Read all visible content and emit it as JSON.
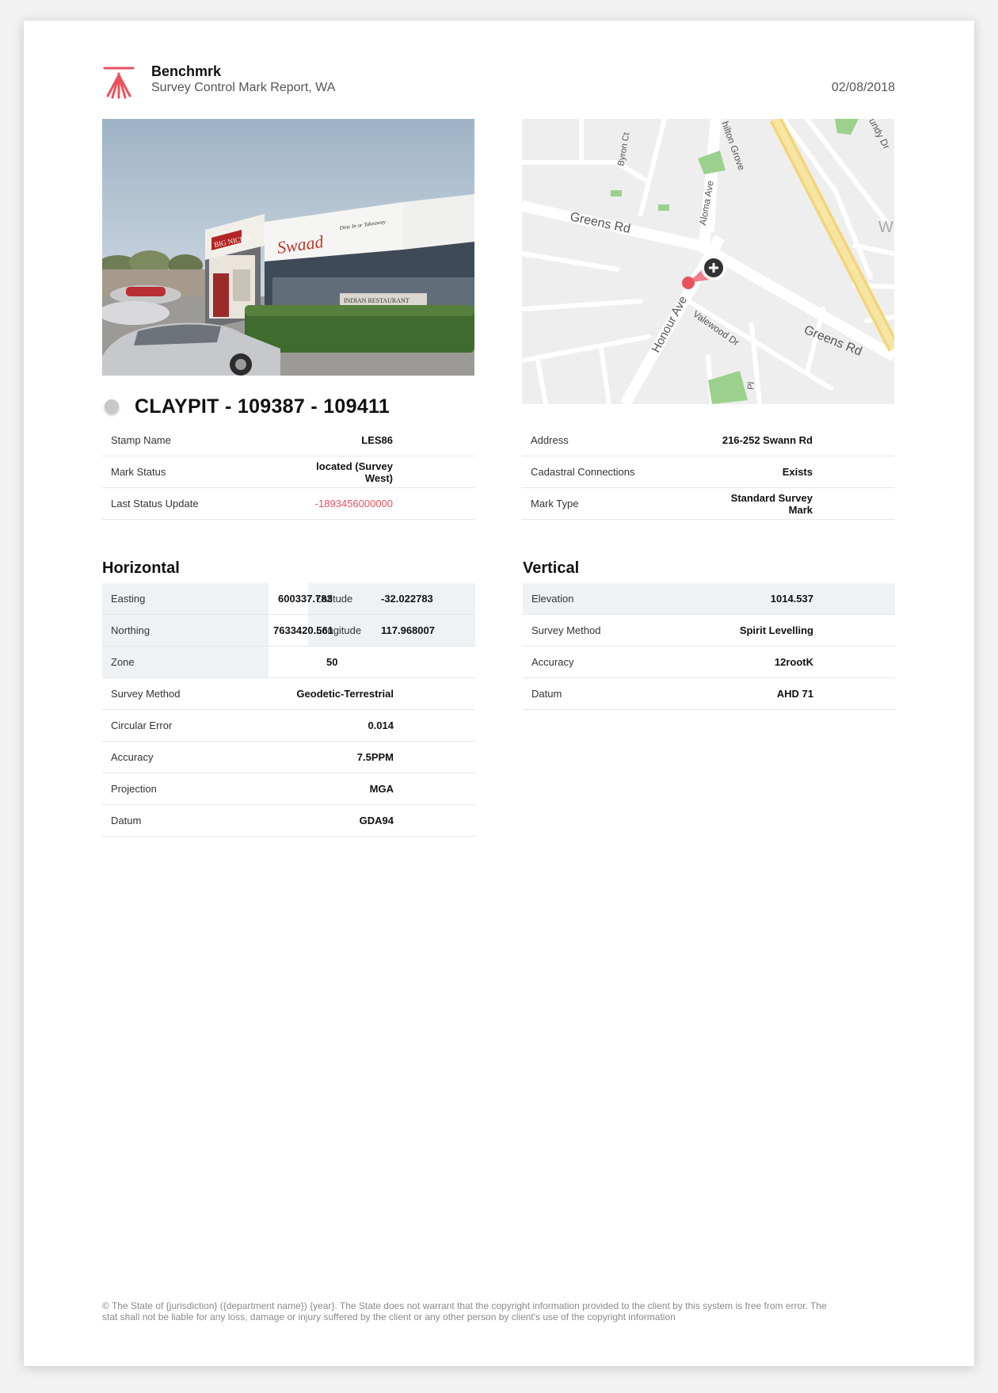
{
  "header": {
    "brand": "Benchmrk",
    "subtitle": "Survey Control Mark Report, WA",
    "date": "02/08/2018"
  },
  "colors": {
    "accent": "#e8525f",
    "shade": "#eff2f5"
  },
  "photo": {
    "sign_left": "BIG NICK'S",
    "sign_right": "Swaad",
    "sign_right_sub": "Dine In or Takeaway",
    "restaurant": "INDIAN RESTAURANT"
  },
  "map": {
    "streets": {
      "greens_left": "Greens Rd",
      "greens_right": "Greens Rd",
      "byron": "Byron Ct",
      "hilton": "hilton Grove",
      "aloma": "Aloma Ave",
      "honour": "Honour Ave",
      "valewood": "Valewood Dr",
      "sundy": "undy Dr",
      "pl": "Pl",
      "w": "W"
    },
    "add_icon": "plus-circle-icon",
    "pin_icon": "map-pin-icon"
  },
  "mark": {
    "status_icon": "status-dot-icon",
    "title": "CLAYPIT - 109387 - 109411"
  },
  "info_left": [
    {
      "label": "Stamp Name",
      "value": "LES86"
    },
    {
      "label": "Mark Status",
      "value": "located (Survey West)"
    },
    {
      "label": "Last Status Update",
      "value": "-1893456000000"
    }
  ],
  "info_right": [
    {
      "label": "Address",
      "value": "216-252 Swann Rd"
    },
    {
      "label": "Cadastral Connections",
      "value": "Exists"
    },
    {
      "label": "Mark Type",
      "value": "Standard Survey Mark"
    }
  ],
  "horizontal": {
    "title": "Horizontal",
    "easting": {
      "label": "Easting",
      "value": "600337.783"
    },
    "northing": {
      "label": "Northing",
      "value": "7633420.561"
    },
    "zone": {
      "label": "Zone",
      "value": "50"
    },
    "latitude": {
      "label": "Latitude",
      "value": "-32.022783"
    },
    "longitude": {
      "label": "Longitude",
      "value": "117.968007"
    },
    "rows": [
      {
        "label": "Survey Method",
        "value": "Geodetic-Terrestrial"
      },
      {
        "label": "Circular Error",
        "value": "0.014"
      },
      {
        "label": "Accuracy",
        "value": "7.5PPM"
      },
      {
        "label": "Projection",
        "value": "MGA"
      },
      {
        "label": "Datum",
        "value": "GDA94"
      }
    ]
  },
  "vertical": {
    "title": "Vertical",
    "rows": [
      {
        "label": "Elevation",
        "value": "1014.537"
      },
      {
        "label": "Survey Method",
        "value": "Spirit Levelling"
      },
      {
        "label": "Accuracy",
        "value": "12rootK"
      },
      {
        "label": "Datum",
        "value": "AHD 71"
      }
    ]
  },
  "footer": {
    "line1": "© The State of {jurisdiction} ({department name}) {year}. The State does not warrant that the copyright information provided to the client by this system is free from error. The",
    "line2": "stat shall not be liable for any loss, damage or injury suffered by the client or any other person by client's use of the copyright information"
  }
}
